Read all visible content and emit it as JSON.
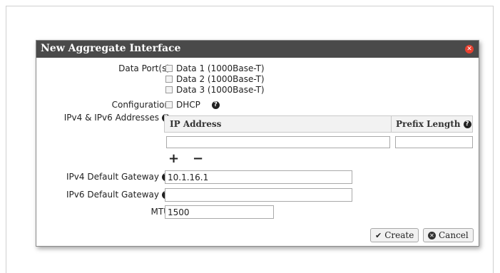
{
  "dialog": {
    "title": "New Aggregate Interface",
    "close_icon": "close-circle-icon"
  },
  "form": {
    "data_ports_label": "Data Port(s)",
    "data_ports": [
      {
        "label": "Data 1 (1000Base-T)",
        "checked": false
      },
      {
        "label": "Data 2 (1000Base-T)",
        "checked": false
      },
      {
        "label": "Data 3 (1000Base-T)",
        "checked": false
      }
    ],
    "configuration_label": "Configuration",
    "dhcp_label": "DHCP",
    "dhcp_checked": false,
    "addresses_label": "IPv4 & IPv6 Addresses",
    "addresses_table": {
      "columns": [
        "IP Address",
        "Prefix Length"
      ],
      "rows": [
        {
          "ip": "",
          "prefix": ""
        }
      ]
    },
    "add_symbol": "+",
    "remove_symbol": "−",
    "ipv4_gateway_label": "IPv4 Default Gateway",
    "ipv4_gateway_value": "10.1.16.1",
    "ipv6_gateway_label": "IPv6 Default Gateway",
    "ipv6_gateway_value": "",
    "mtu_label": "MTU",
    "mtu_value": "1500",
    "help_glyph": "?"
  },
  "buttons": {
    "create_label": "Create",
    "create_icon": "check-icon",
    "cancel_label": "Cancel",
    "cancel_icon": "cancel-circle-icon"
  },
  "colors": {
    "titlebar": "#4a4a4a",
    "close": "#e8402f"
  }
}
